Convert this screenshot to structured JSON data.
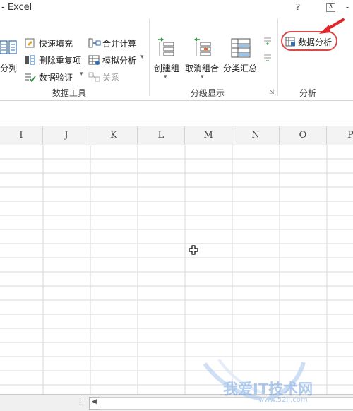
{
  "app": {
    "title": "- Excel"
  },
  "window": {
    "help": "?",
    "restore": "⊼",
    "minimize": "-"
  },
  "ribbon": {
    "data_tools": {
      "split_label": "分列",
      "flash_fill": "快速填充",
      "remove_duplicates": "删除重复项",
      "data_validation": "数据验证",
      "consolidate": "合并计算",
      "what_if": "模拟分析",
      "relationships": "关系",
      "group_label": "数据工具"
    },
    "outline": {
      "group": "创建组",
      "ungroup": "取消组合",
      "subtotal": "分类汇总",
      "group_label": "分级显示"
    },
    "analysis": {
      "data_analysis": "数据分析",
      "group_label": "分析"
    }
  },
  "sheet": {
    "columns": [
      "I",
      "J",
      "K",
      "L",
      "M",
      "N",
      "O",
      "P"
    ]
  },
  "watermark": {
    "text": "我爱IT技术网",
    "url": "www.52ij.com"
  },
  "colors": {
    "accent": "#217346",
    "highlight": "#d84a4a",
    "grid": "#d4d4d4"
  }
}
